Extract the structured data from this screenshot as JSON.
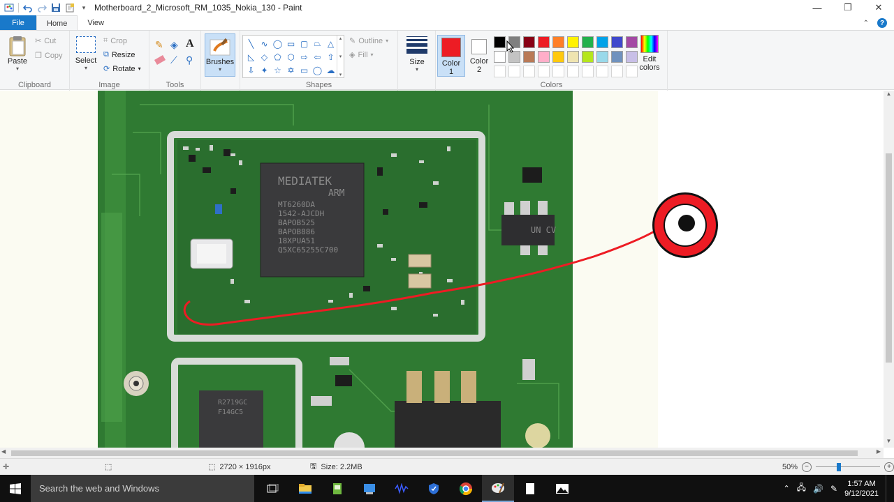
{
  "window": {
    "title": "Motherboard_2_Microsoft_RM_1035_Nokia_130 - Paint",
    "controls": [
      "minimize-icon",
      "restore-icon",
      "close-icon"
    ]
  },
  "tabs": [
    {
      "label": "File"
    },
    {
      "label": "Home"
    },
    {
      "label": "View"
    }
  ],
  "ribbon": {
    "clipboard": {
      "label": "Clipboard",
      "paste": "Paste",
      "cut": "Cut",
      "copy": "Copy"
    },
    "image": {
      "label": "Image",
      "select": "Select",
      "crop": "Crop",
      "resize": "Resize",
      "rotate": "Rotate"
    },
    "tools": {
      "label": "Tools"
    },
    "brushes": {
      "label": "Brushes"
    },
    "shapes": {
      "label": "Shapes",
      "outline": "Outline",
      "fill": "Fill"
    },
    "size": {
      "label": "Size"
    },
    "colors": {
      "label": "Colors",
      "color1": "Color\n1",
      "color1_a": "Color",
      "color1_b": "1",
      "color2_a": "Color",
      "color2_b": "2",
      "edit": "Edit colors",
      "edit_a": "Edit",
      "edit_b": "colors",
      "color1_value": "#ed1c24",
      "color2_value": "#ffffff",
      "palette_row1": [
        "#000000",
        "#7f7f7f",
        "#880015",
        "#ed1c24",
        "#ff7f27",
        "#fff200",
        "#22b14c",
        "#00a2e8",
        "#3f48cc",
        "#a349a4"
      ],
      "palette_row2": [
        "#ffffff",
        "#c3c3c3",
        "#b97a57",
        "#ffaec9",
        "#ffc90e",
        "#efe4b0",
        "#b5e61d",
        "#99d9ea",
        "#7092be",
        "#c8bfe7"
      ]
    }
  },
  "canvas": {
    "chip_text_lines": [
      "MEDIATEK",
      "ARM",
      "MT6260DA",
      "1542-AJCDH",
      "BAPOB525",
      "BAPOB886",
      "18XPUA51",
      "Q5XC65255C700"
    ],
    "chip2_text_lines": [
      "R2719GC",
      "F14GC5"
    ],
    "ic_text": "UN CV",
    "marker_color": "#ed1c24"
  },
  "status": {
    "dimensions": "2720 × 1916px",
    "size": "Size: 2.2MB",
    "zoom": "50%"
  },
  "taskbar": {
    "search_placeholder": "Search the web and Windows",
    "time": "1:57 AM",
    "date": "9/12/2021"
  }
}
